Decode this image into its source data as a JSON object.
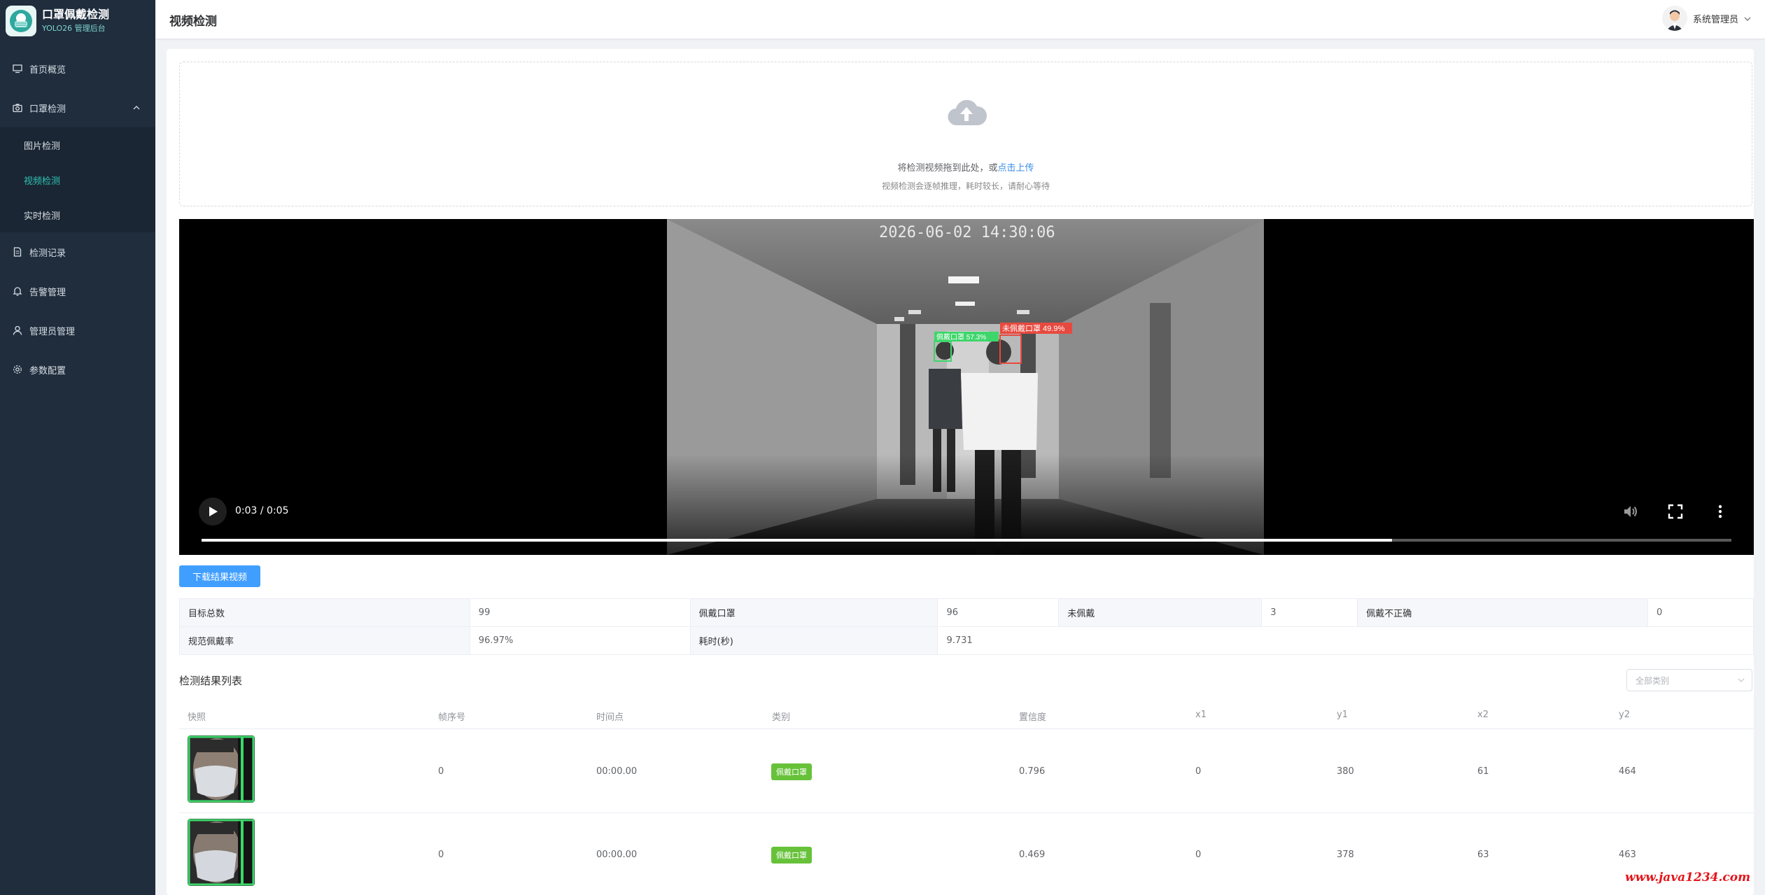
{
  "app": {
    "title": "口罩佩戴检测",
    "subtitle": "YOLO26 管理后台"
  },
  "sidebar": {
    "items": [
      {
        "label": "首页概览",
        "icon": "monitor-icon"
      },
      {
        "label": "口罩检测",
        "icon": "camera-icon",
        "expanded": true,
        "children": [
          {
            "label": "图片检测",
            "active": false
          },
          {
            "label": "视频检测",
            "active": true
          },
          {
            "label": "实时检测",
            "active": false
          }
        ]
      },
      {
        "label": "检测记录",
        "icon": "document-icon"
      },
      {
        "label": "告警管理",
        "icon": "bell-icon"
      },
      {
        "label": "管理员管理",
        "icon": "user-icon"
      },
      {
        "label": "参数配置",
        "icon": "gear-icon"
      }
    ]
  },
  "header": {
    "title": "视频检测",
    "user": "系统管理员"
  },
  "upload": {
    "text": "将检测视频拖到此处，或",
    "link": "点击上传",
    "tip": "视频检测会逐帧推理，耗时较长，请耐心等待"
  },
  "video": {
    "timestamp": "2026-06-02  14:30:06",
    "time": "0:03 / 0:05",
    "progress": 0.778,
    "detections": [
      {
        "label": "佩戴口罩 57.3%",
        "color": "#3ed66b"
      },
      {
        "label": "未佩戴口罩 49.9%",
        "color": "#e8493f"
      }
    ]
  },
  "download_button": "下载结果视频",
  "stats": {
    "total_label": "目标总数",
    "total": "99",
    "mask_label": "佩戴口罩",
    "mask": "96",
    "nomask_label": "未佩戴",
    "nomask": "3",
    "incorrect_label": "佩戴不正确",
    "incorrect": "0",
    "rate_label": "规范佩戴率",
    "rate": "96.97%",
    "time_label": "耗时(秒)",
    "time": "9.731"
  },
  "results": {
    "title": "检测结果列表",
    "filter_placeholder": "全部类别",
    "columns": [
      "快照",
      "帧序号",
      "时间点",
      "类别",
      "置信度",
      "x1",
      "y1",
      "x2",
      "y2"
    ],
    "rows": [
      {
        "frame": "0",
        "time": "00:00.00",
        "category": "佩戴口罩",
        "conf": "0.796",
        "x1": "0",
        "y1": "380",
        "x2": "61",
        "y2": "464"
      },
      {
        "frame": "0",
        "time": "00:00.00",
        "category": "佩戴口罩",
        "conf": "0.469",
        "x1": "0",
        "y1": "378",
        "x2": "63",
        "y2": "463"
      }
    ]
  },
  "watermark": "www.java1234.com",
  "colors": {
    "sidebar": "#1f2d3d",
    "accent": "#2fc2b6",
    "primary": "#409eff",
    "tag": "#67c23a"
  }
}
